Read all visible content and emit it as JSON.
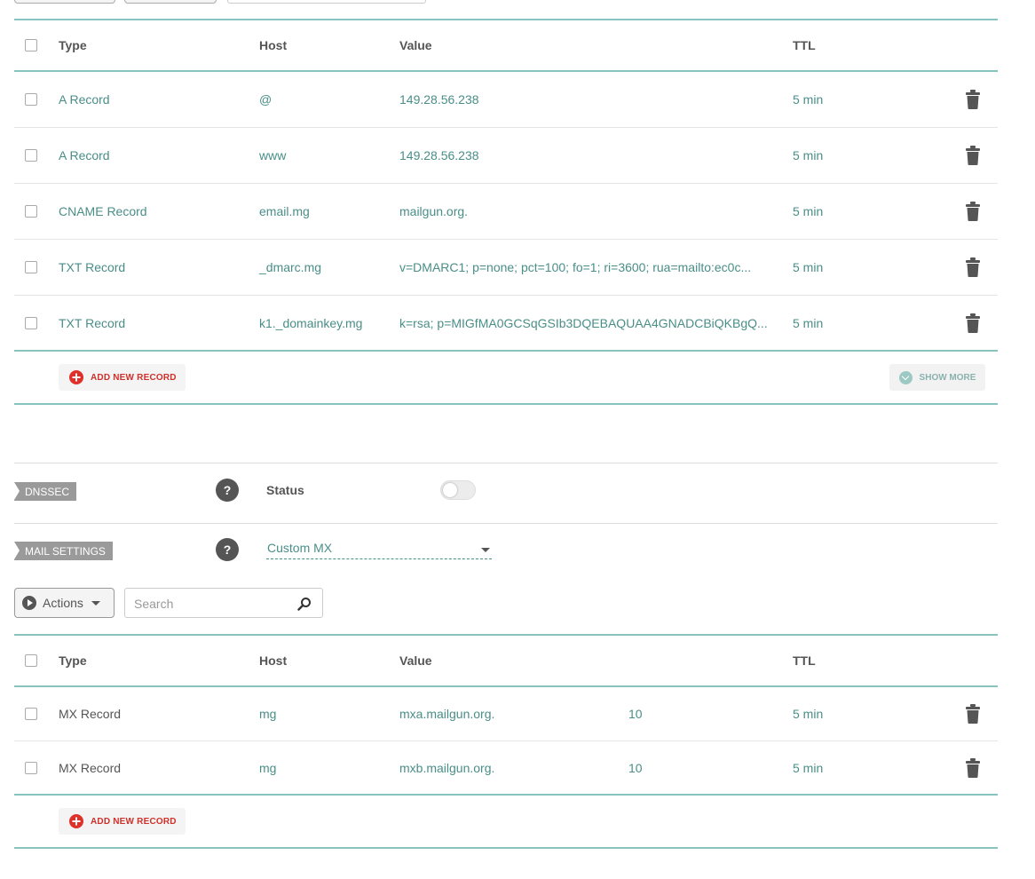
{
  "colors": {
    "accent": "#86c5bf",
    "link": "#4a8e88",
    "danger": "#e0302a",
    "tag": "#9a9a9a"
  },
  "columns": {
    "type": "Type",
    "host": "Host",
    "value": "Value",
    "ttl": "TTL"
  },
  "records": [
    {
      "type": "A Record",
      "host": "@",
      "value": "149.28.56.238",
      "ttl": "5 min"
    },
    {
      "type": "A Record",
      "host": "www",
      "value": "149.28.56.238",
      "ttl": "5 min"
    },
    {
      "type": "CNAME Record",
      "host": "email.mg",
      "value": "mailgun.org.",
      "ttl": "5 min"
    },
    {
      "type": "TXT Record",
      "host": "_dmarc.mg",
      "value": "v=DMARC1; p=none; pct=100; fo=1; ri=3600; rua=mailto:ec0c...",
      "ttl": "5 min"
    },
    {
      "type": "TXT Record",
      "host": "k1._domainkey.mg",
      "value": "k=rsa; p=MIGfMA0GCSqGSIb3DQEBAQUAA4GNADCBiQKBgQ...",
      "ttl": "5 min"
    }
  ],
  "add_new_record": "ADD NEW RECORD",
  "show_more": "SHOW MORE",
  "dnssec": {
    "tag": "DNSSEC",
    "help": "?",
    "status_label": "Status"
  },
  "mail": {
    "tag": "MAIL SETTINGS",
    "help": "?",
    "selected": "Custom MX"
  },
  "toolbar": {
    "actions": "Actions",
    "search_placeholder": "Search"
  },
  "mx_records": [
    {
      "type": "MX Record",
      "host": "mg",
      "value": "mxa.mailgun.org.",
      "priority": "10",
      "ttl": "5 min"
    },
    {
      "type": "MX Record",
      "host": "mg",
      "value": "mxb.mailgun.org.",
      "priority": "10",
      "ttl": "5 min"
    }
  ]
}
